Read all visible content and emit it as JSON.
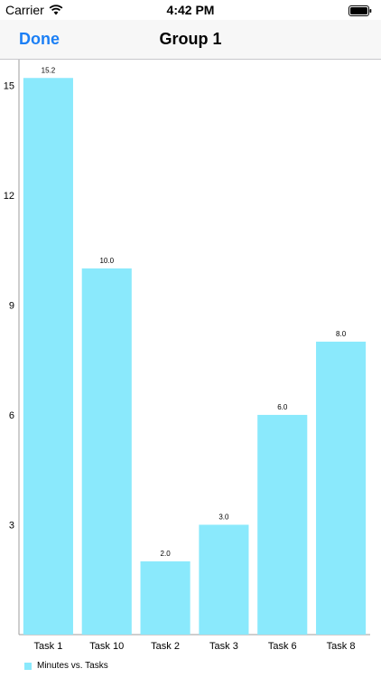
{
  "status_bar": {
    "carrier": "Carrier",
    "time": "4:42 PM"
  },
  "nav": {
    "done_label": "Done",
    "title": "Group 1"
  },
  "colors": {
    "accent": "#1b7ff5",
    "bar": "#8ae9fc"
  },
  "chart_data": {
    "type": "bar",
    "categories": [
      "Task 1",
      "Task 10",
      "Task 2",
      "Task 3",
      "Task 6",
      "Task 8"
    ],
    "series": [
      {
        "name": "Minutes vs. Tasks",
        "values": [
          15.2,
          10.0,
          2.0,
          3.0,
          6.0,
          8.0
        ],
        "value_labels": [
          "15.2",
          "10.0",
          "2.0",
          "3.0",
          "6.0",
          "8.0"
        ]
      }
    ],
    "yticks": [
      3,
      6,
      9,
      12,
      15
    ],
    "ylim": [
      0,
      15.7
    ],
    "grid": false,
    "legend_position": "bottom-left"
  }
}
